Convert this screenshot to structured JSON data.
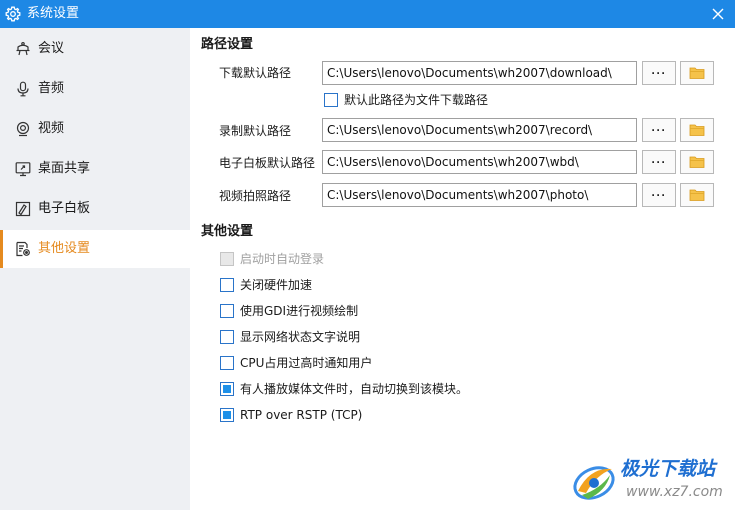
{
  "window": {
    "title": "系统设置",
    "accent_color": "#1e88e5",
    "active_color": "#e58a1f"
  },
  "sidebar": {
    "items": [
      {
        "label": "会议",
        "icon": "meeting-icon",
        "active": false
      },
      {
        "label": "音频",
        "icon": "microphone-icon",
        "active": false
      },
      {
        "label": "视频",
        "icon": "webcam-icon",
        "active": false
      },
      {
        "label": "桌面共享",
        "icon": "monitor-icon",
        "active": false
      },
      {
        "label": "电子白板",
        "icon": "whiteboard-icon",
        "active": false
      },
      {
        "label": "其他设置",
        "icon": "settings-doc-icon",
        "active": true
      }
    ]
  },
  "paths": {
    "title": "路径设置",
    "browse_label": "···",
    "download": {
      "label": "下载默认路径",
      "value": "C:\\Users\\lenovo\\Documents\\wh2007\\download\\"
    },
    "use_for_download": {
      "label": "默认此路径为文件下载路径",
      "checked": false
    },
    "record": {
      "label": "录制默认路径",
      "value": "C:\\Users\\lenovo\\Documents\\wh2007\\record\\"
    },
    "whiteboard": {
      "label": "电子白板默认路径",
      "value": "C:\\Users\\lenovo\\Documents\\wh2007\\wbd\\"
    },
    "photo": {
      "label": "视频拍照路径",
      "value": "C:\\Users\\lenovo\\Documents\\wh2007\\photo\\"
    }
  },
  "other": {
    "title": "其他设置",
    "options": [
      {
        "label": "启动时自动登录",
        "checked": false,
        "disabled": true
      },
      {
        "label": "关闭硬件加速",
        "checked": false,
        "disabled": false
      },
      {
        "label": "使用GDI进行视频绘制",
        "checked": false,
        "disabled": false
      },
      {
        "label": "显示网络状态文字说明",
        "checked": false,
        "disabled": false
      },
      {
        "label": "CPU占用过高时通知用户",
        "checked": false,
        "disabled": false
      },
      {
        "label": "有人播放媒体文件时，自动切换到该模块。",
        "checked": true,
        "disabled": false
      },
      {
        "label": "RTP over RSTP (TCP)",
        "checked": true,
        "disabled": false
      }
    ]
  },
  "watermark": {
    "name": "极光下载站",
    "url": "www.xz7.com"
  }
}
